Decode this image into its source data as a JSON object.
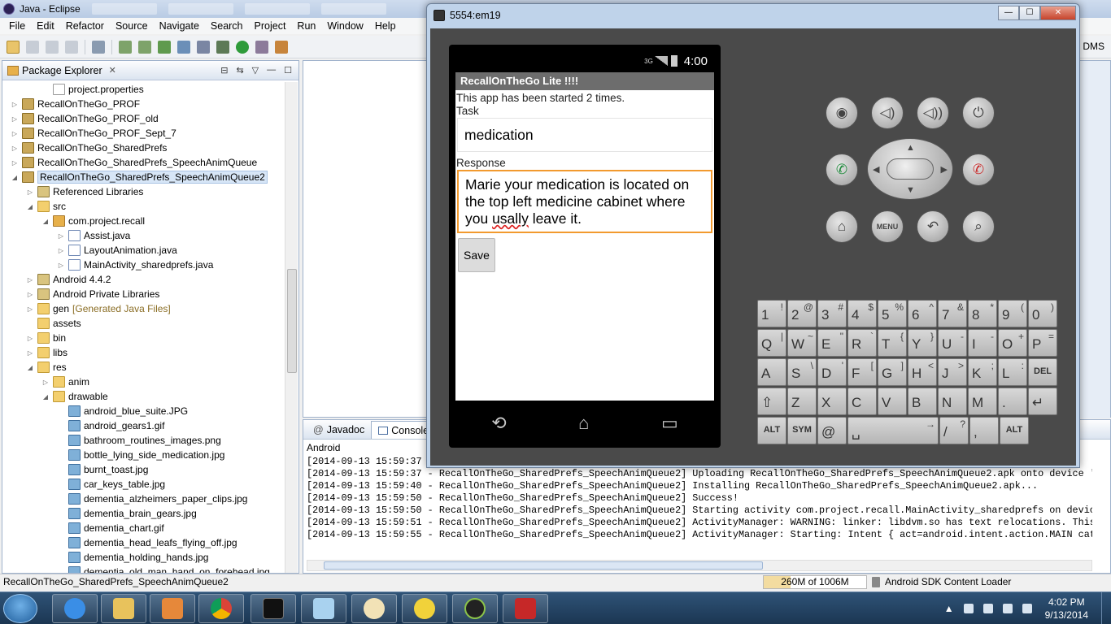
{
  "eclipse": {
    "title": "Java - Eclipse",
    "menu": [
      "File",
      "Edit",
      "Refactor",
      "Source",
      "Navigate",
      "Search",
      "Project",
      "Run",
      "Window",
      "Help"
    ],
    "perspective_label": "DMS"
  },
  "package_explorer": {
    "title": "Package Explorer",
    "rows": [
      {
        "label": "project.properties",
        "indent": 2,
        "twisty": "",
        "icon": "file"
      },
      {
        "label": "RecallOnTheGo_PROF",
        "indent": 0,
        "twisty": "▷",
        "icon": "proj"
      },
      {
        "label": "RecallOnTheGo_PROF_old",
        "indent": 0,
        "twisty": "▷",
        "icon": "proj"
      },
      {
        "label": "RecallOnTheGo_PROF_Sept_7",
        "indent": 0,
        "twisty": "▷",
        "icon": "proj"
      },
      {
        "label": "RecallOnTheGo_SharedPrefs",
        "indent": 0,
        "twisty": "▷",
        "icon": "proj"
      },
      {
        "label": "RecallOnTheGo_SharedPrefs_SpeechAnimQueue",
        "indent": 0,
        "twisty": "▷",
        "icon": "proj"
      },
      {
        "label": "RecallOnTheGo_SharedPrefs_SpeechAnimQueue2",
        "indent": 0,
        "twisty": "◢",
        "icon": "proj",
        "selected": true
      },
      {
        "label": "Referenced Libraries",
        "indent": 1,
        "twisty": "▷",
        "icon": "lib"
      },
      {
        "label": "src",
        "indent": 1,
        "twisty": "◢",
        "icon": "folder"
      },
      {
        "label": "com.project.recall",
        "indent": 2,
        "twisty": "◢",
        "icon": "pkgic"
      },
      {
        "label": "Assist.java",
        "indent": 3,
        "twisty": "▷",
        "icon": "java"
      },
      {
        "label": "LayoutAnimation.java",
        "indent": 3,
        "twisty": "▷",
        "icon": "java"
      },
      {
        "label": "MainActivity_sharedprefs.java",
        "indent": 3,
        "twisty": "▷",
        "icon": "java"
      },
      {
        "label": "Android 4.4.2",
        "indent": 1,
        "twisty": "▷",
        "icon": "lib"
      },
      {
        "label": "Android Private Libraries",
        "indent": 1,
        "twisty": "▷",
        "icon": "lib"
      },
      {
        "label": "gen",
        "indent": 1,
        "twisty": "▷",
        "icon": "folder",
        "extra": "[Generated Java Files]"
      },
      {
        "label": "assets",
        "indent": 1,
        "twisty": "",
        "icon": "folder"
      },
      {
        "label": "bin",
        "indent": 1,
        "twisty": "▷",
        "icon": "folder"
      },
      {
        "label": "libs",
        "indent": 1,
        "twisty": "▷",
        "icon": "folder"
      },
      {
        "label": "res",
        "indent": 1,
        "twisty": "◢",
        "icon": "folder"
      },
      {
        "label": "anim",
        "indent": 2,
        "twisty": "▷",
        "icon": "folder"
      },
      {
        "label": "drawable",
        "indent": 2,
        "twisty": "◢",
        "icon": "folder"
      },
      {
        "label": "android_blue_suite.JPG",
        "indent": 3,
        "twisty": "",
        "icon": "img"
      },
      {
        "label": "android_gears1.gif",
        "indent": 3,
        "twisty": "",
        "icon": "img"
      },
      {
        "label": "bathroom_routines_images.png",
        "indent": 3,
        "twisty": "",
        "icon": "img"
      },
      {
        "label": "bottle_lying_side_medication.jpg",
        "indent": 3,
        "twisty": "",
        "icon": "img"
      },
      {
        "label": "burnt_toast.jpg",
        "indent": 3,
        "twisty": "",
        "icon": "img"
      },
      {
        "label": "car_keys_table.jpg",
        "indent": 3,
        "twisty": "",
        "icon": "img"
      },
      {
        "label": "dementia_alzheimers_paper_clips.jpg",
        "indent": 3,
        "twisty": "",
        "icon": "img"
      },
      {
        "label": "dementia_brain_gears.jpg",
        "indent": 3,
        "twisty": "",
        "icon": "img"
      },
      {
        "label": "dementia_chart.gif",
        "indent": 3,
        "twisty": "",
        "icon": "img"
      },
      {
        "label": "dementia_head_leafs_flying_off.jpg",
        "indent": 3,
        "twisty": "",
        "icon": "img"
      },
      {
        "label": "dementia_holding_hands.jpg",
        "indent": 3,
        "twisty": "",
        "icon": "img"
      },
      {
        "label": "dementia_old_man_hand_on_forehead.jpg",
        "indent": 3,
        "twisty": "",
        "icon": "img"
      }
    ]
  },
  "console": {
    "tabs": [
      "Javadoc",
      "Console"
    ],
    "active_tab": "Console",
    "label": "Android",
    "lines": [
      "[2014-09-13 15:59:37 - RecallOnTheGo_SharedPrefs_SpeechAnimQueue2] ",
      "[2014-09-13 15:59:37 - RecallOnTheGo_SharedPrefs_SpeechAnimQueue2] Uploading RecallOnTheGo_SharedPrefs_SpeechAnimQueue2.apk onto device 'em",
      "[2014-09-13 15:59:40 - RecallOnTheGo_SharedPrefs_SpeechAnimQueue2] Installing RecallOnTheGo_SharedPrefs_SpeechAnimQueue2.apk...",
      "[2014-09-13 15:59:50 - RecallOnTheGo_SharedPrefs_SpeechAnimQueue2] Success!",
      "[2014-09-13 15:59:50 - RecallOnTheGo_SharedPrefs_SpeechAnimQueue2] Starting activity com.project.recall.MainActivity_sharedprefs on device",
      "[2014-09-13 15:59:51 - RecallOnTheGo_SharedPrefs_SpeechAnimQueue2] ActivityManager: WARNING: linker: libdvm.so has text relocations. This i",
      "[2014-09-13 15:59:55 - RecallOnTheGo_SharedPrefs_SpeechAnimQueue2] ActivityManager: Starting: Intent { act=android.intent.action.MAIN cat=["
    ]
  },
  "statusbar": {
    "selection": "RecallOnTheGo_SharedPrefs_SpeechAnimQueue2",
    "heap": "260M of 1006M",
    "heap_fraction": 0.26,
    "loader": "Android SDK Content Loader"
  },
  "emulator": {
    "title": "5554:em19",
    "status_time": "4:00",
    "network": "3G",
    "app": {
      "title": "RecallOnTheGo Lite !!!!",
      "started_text": "This app has been started 2 times.",
      "task_label": "Task",
      "task_value": "medication",
      "response_label": "Response",
      "response_before": "Marie your medication is located on the top left medicine cabinet where you ",
      "response_misspelled": "usally",
      "response_after": " leave it.",
      "save_label": "Save"
    },
    "keyboard": [
      [
        [
          "1",
          "!"
        ],
        [
          "2",
          "@"
        ],
        [
          "3",
          "#"
        ],
        [
          "4",
          "$"
        ],
        [
          "5",
          "%"
        ],
        [
          "6",
          "^"
        ],
        [
          "7",
          "&"
        ],
        [
          "8",
          "*"
        ],
        [
          "9",
          "("
        ],
        [
          "0",
          ")"
        ]
      ],
      [
        [
          "Q",
          "|"
        ],
        [
          "W",
          "~"
        ],
        [
          "E",
          "\""
        ],
        [
          "R",
          "`"
        ],
        [
          "T",
          "{"
        ],
        [
          "Y",
          "}"
        ],
        [
          "U",
          "-"
        ],
        [
          "I",
          "-"
        ],
        [
          "O",
          "+"
        ],
        [
          "P",
          "="
        ]
      ],
      [
        [
          "A",
          ""
        ],
        [
          "S",
          "\\"
        ],
        [
          "D",
          "'"
        ],
        [
          "F",
          "["
        ],
        [
          "G",
          "]"
        ],
        [
          "H",
          "<"
        ],
        [
          "J",
          ">"
        ],
        [
          "K",
          ";"
        ],
        [
          "L",
          ":"
        ],
        [
          "DEL",
          ""
        ]
      ],
      [
        [
          "⇧",
          ""
        ],
        [
          "Z",
          ""
        ],
        [
          "X",
          ""
        ],
        [
          "C",
          ""
        ],
        [
          "V",
          ""
        ],
        [
          "B",
          ""
        ],
        [
          "N",
          ""
        ],
        [
          "M",
          ""
        ],
        [
          ".",
          ""
        ],
        [
          "↵",
          ""
        ]
      ],
      [
        [
          "ALT",
          ""
        ],
        [
          "SYM",
          ""
        ],
        [
          "@",
          ""
        ],
        [
          "␣",
          "→"
        ],
        [
          "/",
          "?"
        ],
        [
          ",",
          ""
        ],
        [
          "ALT",
          ""
        ]
      ]
    ],
    "hw_buttons": [
      "camera-icon",
      "volume-down-icon",
      "volume-up-icon",
      "power-icon",
      "call-icon",
      "end-call-icon",
      "home-icon",
      "menu-button",
      "back-icon",
      "search-icon"
    ],
    "menu_label": "MENU"
  },
  "taskbar": {
    "time": "4:02 PM",
    "date": "9/13/2014",
    "apps": [
      "internet-explorer-icon",
      "file-explorer-icon",
      "media-player-icon",
      "chrome-icon",
      "command-prompt-icon",
      "notepad-icon",
      "paint-icon",
      "json-editor-icon",
      "android-emulator-icon",
      "filezilla-icon"
    ]
  }
}
